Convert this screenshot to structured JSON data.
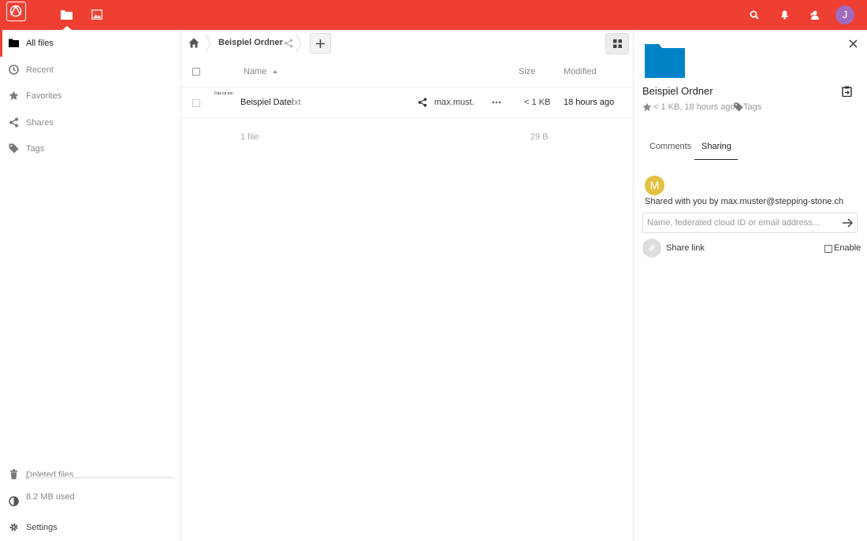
{
  "header": {
    "colors": {
      "brand": "#ef3f33"
    },
    "apps": [
      "files-icon",
      "gallery-icon"
    ],
    "user_initial": "J",
    "icons": [
      "search-icon",
      "bell-icon",
      "contacts-icon"
    ]
  },
  "sidebar": {
    "items": [
      {
        "label": "All files",
        "icon": "folder-icon"
      },
      {
        "label": "Recent",
        "icon": "clock-icon"
      },
      {
        "label": "Favorites",
        "icon": "star-icon"
      },
      {
        "label": "Shares",
        "icon": "share-icon"
      },
      {
        "label": "Tags",
        "icon": "tag-icon"
      }
    ],
    "deleted_files": "Deleted files",
    "quota": "8.2 MB used",
    "settings": "Settings"
  },
  "breadcrumb": {
    "folder": "Beispiel Ordner"
  },
  "table": {
    "headers": {
      "name": "Name",
      "size": "Size",
      "modified": "Modified"
    },
    "rows": [
      {
        "thumb": "Das ist ein",
        "name": "Beispiel Datei",
        "ext": ".txt",
        "shared_by": "max.must.",
        "size": "< 1 KB",
        "modified": "18 hours ago"
      }
    ],
    "summary": {
      "count": "1 file",
      "size": "29 B"
    }
  },
  "details": {
    "title": "Beispiel Ordner",
    "meta": "< 1 KB, 18 hours ago",
    "tags": "Tags",
    "tabs": [
      "Comments",
      "Sharing"
    ],
    "owner_initial": "M",
    "shared_with": "Shared with you by max.muster@stepping-stone.ch",
    "share_placeholder": "Name, federated cloud ID or email address...",
    "share_link": "Share link",
    "enable": "Enable"
  }
}
